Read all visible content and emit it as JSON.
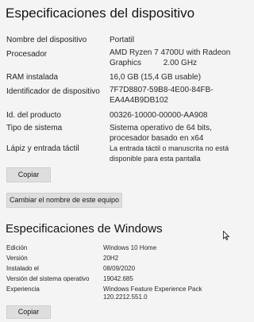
{
  "device_specs": {
    "title": "Especificaciones del dispositivo",
    "rows": [
      {
        "label": "Nombre del dispositivo",
        "value_lines": [
          "Portatil"
        ]
      },
      {
        "label": "Procesador",
        "value_lines": [
          "AMD Ryzen 7 4700U with Radeon",
          "Graphics          2.00 GHz"
        ]
      },
      {
        "label": "RAM instalada",
        "value_lines": [
          "16,0 GB (15,4 GB usable)"
        ]
      },
      {
        "label": "Identificador de dispositivo",
        "value_lines": [
          "7F7D8807-59B8-4E00-84FB-",
          "EA4A4B9DB102"
        ]
      },
      {
        "label": "Id. del producto",
        "value_lines": [
          "00326-10000-00000-AA908"
        ]
      },
      {
        "label": "Tipo de sistema",
        "value_lines": [
          "Sistema operativo de 64 bits,",
          "procesador basado en x64"
        ]
      },
      {
        "label": "Lápiz y entrada táctil",
        "value_lines": [
          "La entrada táctil o manuscrita no está",
          "disponible para esta pantalla"
        ]
      }
    ],
    "copy_label": "Copiar",
    "rename_label": "Cambiar el nombre de este equipo"
  },
  "windows_specs": {
    "title": "Especificaciones de Windows",
    "rows": [
      {
        "label": "Edición",
        "value_lines": [
          "Windows 10 Home"
        ]
      },
      {
        "label": "Versión",
        "value_lines": [
          "20H2"
        ]
      },
      {
        "label": "Instalado el",
        "value_lines": [
          "08/09/2020"
        ]
      },
      {
        "label": "Versión del sistema operativo",
        "value_lines": [
          "19042.685"
        ]
      },
      {
        "label": "Experiencia",
        "value_lines": [
          "Windows Feature Experience Pack",
          "120.2212.551.0"
        ]
      }
    ],
    "copy_label": "Copiar"
  },
  "icons": {
    "cursor": "mouse-pointer-icon"
  }
}
